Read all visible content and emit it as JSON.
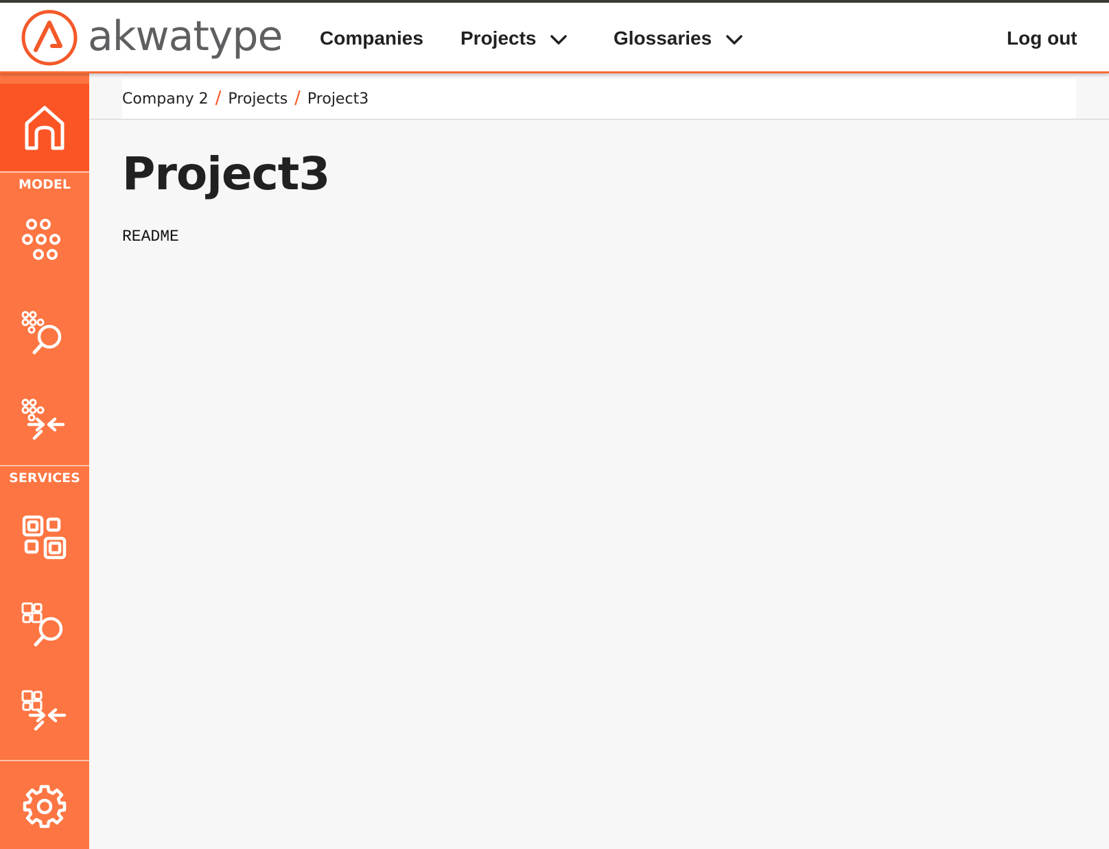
{
  "header": {
    "logo_text": "akwatype",
    "nav": {
      "companies": "Companies",
      "projects": "Projects",
      "glossaries": "Glossaries",
      "logout": "Log out"
    }
  },
  "sidebar": {
    "model_label": "MODEL",
    "services_label": "SERVICES",
    "icons": [
      "home-icon",
      "model-icon",
      "model-search-icon",
      "model-merge-icon",
      "services-icon",
      "services-search-icon",
      "services-merge-icon",
      "gear-icon"
    ]
  },
  "breadcrumb": {
    "items": [
      "Company 2",
      "Projects",
      "Project3"
    ],
    "separator": "/"
  },
  "main": {
    "title": "Project3",
    "readme": "README"
  },
  "colors": {
    "accent": "#f86b35",
    "sidebar": "#fd7542",
    "sidebar_active": "#fb5525"
  }
}
